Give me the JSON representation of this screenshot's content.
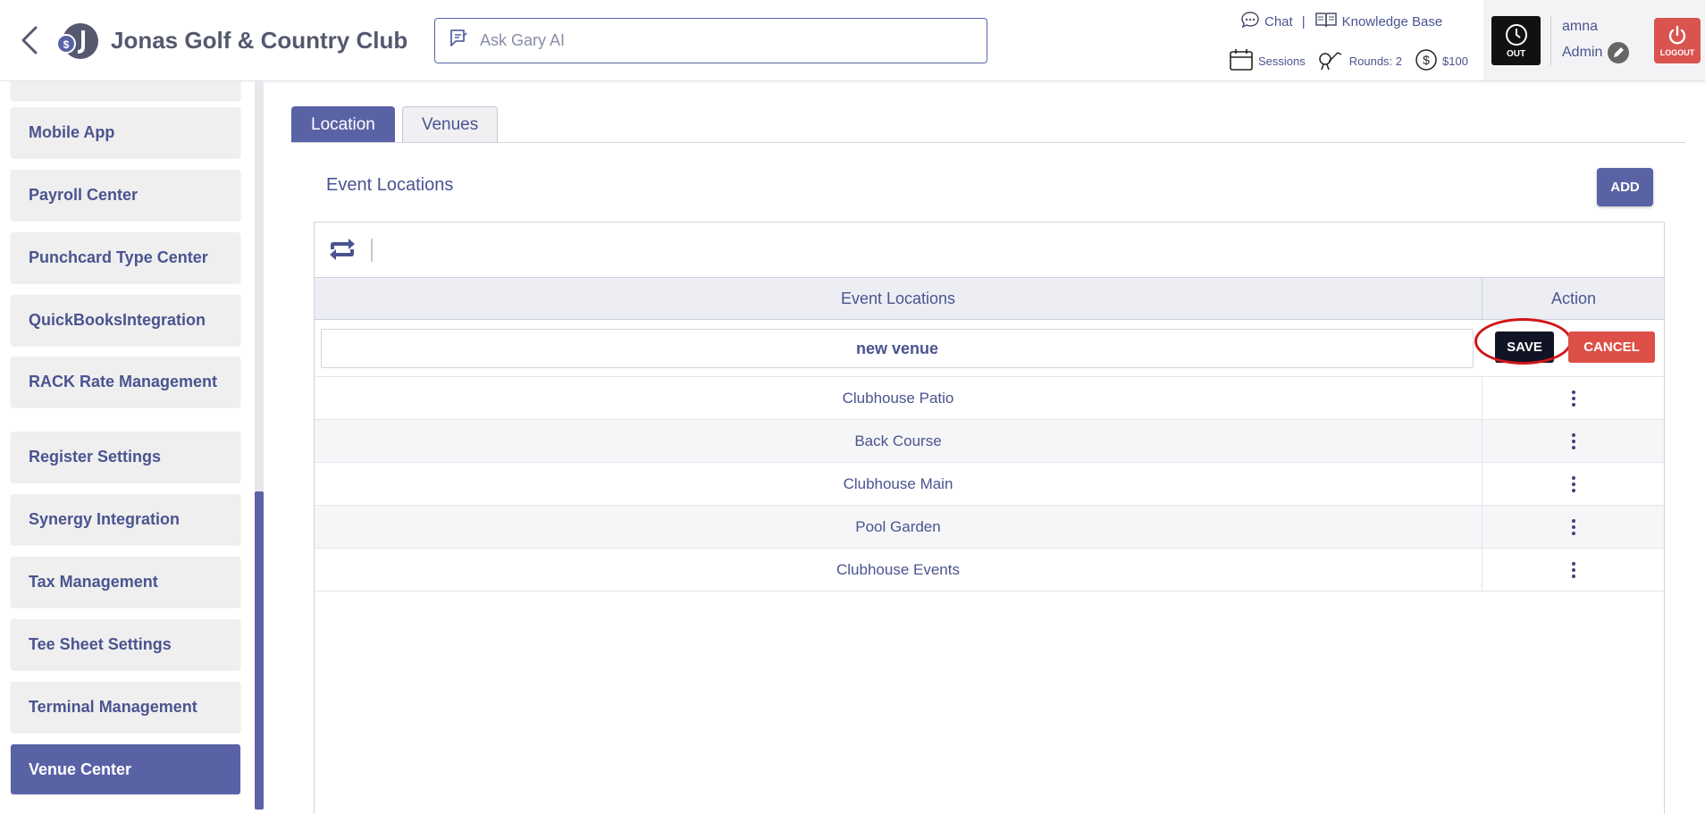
{
  "header": {
    "club_name": "Jonas Golf & Country Club",
    "search_placeholder": "Ask Gary AI",
    "chat_label": "Chat",
    "separator": "|",
    "kb_label": "Knowledge Base",
    "sessions_label": "Sessions",
    "rounds_label": "Rounds: 2",
    "balance_label": "$100",
    "clock_label": "OUT",
    "username": "amna",
    "role": "Admin",
    "logout_label": "LOGOUT"
  },
  "sidebar": {
    "items": [
      {
        "label": "Mobile App"
      },
      {
        "label": "Payroll Center"
      },
      {
        "label": "Punchcard Type Center"
      },
      {
        "label": "QuickBooksIntegration"
      },
      {
        "label": "RACK Rate Management"
      },
      {
        "label": "Register Settings"
      },
      {
        "label": "Synergy Integration"
      },
      {
        "label": "Tax Management"
      },
      {
        "label": "Tee Sheet Settings"
      },
      {
        "label": "Terminal Management"
      },
      {
        "label": "Venue Center"
      }
    ],
    "active": "Venue Center"
  },
  "tabs": [
    {
      "label": "Location",
      "active": true
    },
    {
      "label": "Venues",
      "active": false
    }
  ],
  "main": {
    "title": "Event Locations",
    "add_label": "ADD",
    "columns": [
      "Event Locations",
      "Action"
    ],
    "edit_row": {
      "value": "new venue",
      "save_label": "SAVE",
      "cancel_label": "CANCEL"
    },
    "rows": [
      "Clubhouse Patio",
      "Back Course",
      "Clubhouse Main",
      "Pool Garden",
      "Clubhouse Events"
    ]
  },
  "colors": {
    "accent": "#5a62a6",
    "text": "#4a5490",
    "save": "#101424",
    "cancel": "#dc5048",
    "logout": "#d9534f",
    "highlight_ring": "#d0161a"
  }
}
